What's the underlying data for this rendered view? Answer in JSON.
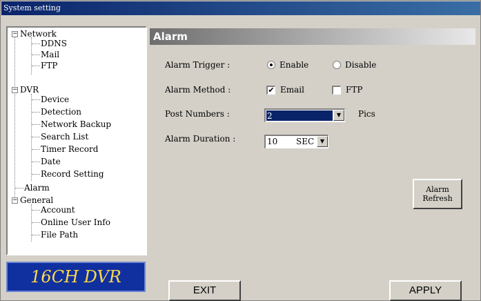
{
  "window": {
    "title": "System setting"
  },
  "tree": {
    "network": {
      "label": "Network",
      "children": [
        "DDNS",
        "Mail",
        "FTP"
      ]
    },
    "dvr": {
      "label": "DVR",
      "children": [
        "Device",
        "Detection",
        "Network Backup",
        "Search List",
        "Timer Record",
        "Date",
        "Record Setting"
      ]
    },
    "alarm": {
      "label": "Alarm"
    },
    "general": {
      "label": "General",
      "children": [
        "Account",
        "Online User Info",
        "File Path"
      ]
    },
    "expander_symbol": "−"
  },
  "logo": {
    "text": "16CH DVR"
  },
  "panel": {
    "title": "Alarm",
    "trigger": {
      "label": "Alarm Trigger :",
      "options": [
        "Enable",
        "Disable"
      ],
      "selected": "Enable"
    },
    "method": {
      "label": "Alarm Method :",
      "email_label": "Email",
      "email_checked": true,
      "ftp_label": "FTP",
      "ftp_checked": false,
      "check_mark": "✔"
    },
    "post_numbers": {
      "label": "Post Numbers :",
      "value": "2",
      "unit": "Pics"
    },
    "duration": {
      "label": "Alarm Duration :",
      "value": "10",
      "unit": "SEC"
    },
    "dropdown_arrow": "▼"
  },
  "buttons": {
    "alarm_refresh": "Alarm Refresh",
    "exit": "EXIT",
    "apply": "APPLY"
  }
}
